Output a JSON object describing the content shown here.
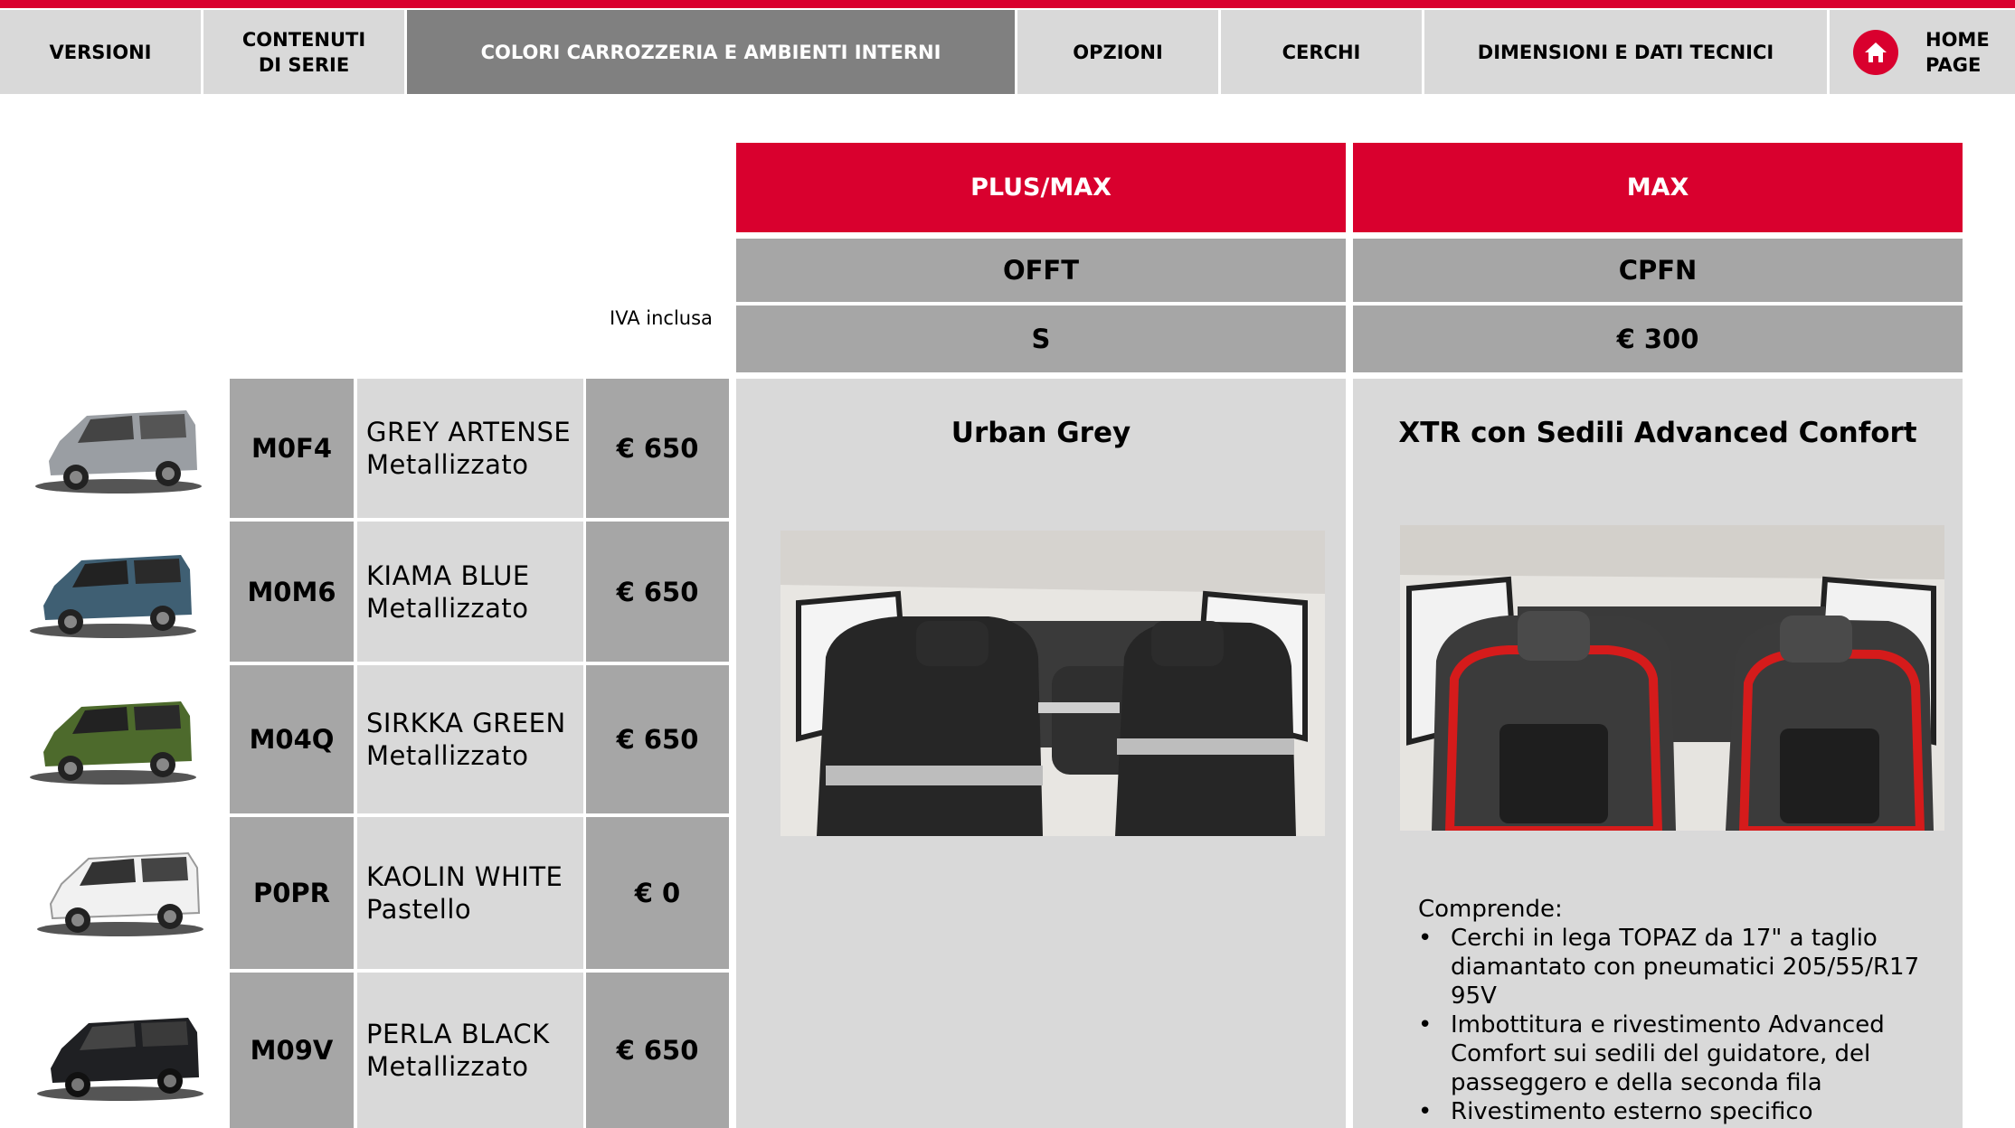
{
  "nav": {
    "tabs": [
      {
        "label": "VERSIONI"
      },
      {
        "label_line1": "CONTENUTI",
        "label_line2": "DI SERIE"
      },
      {
        "label": "COLORI CARROZZERIA E AMBIENTI INTERNI",
        "active": true
      },
      {
        "label": "OPZIONI"
      },
      {
        "label": "CERCHI"
      },
      {
        "label": "DIMENSIONI E DATI TECNICI"
      }
    ],
    "home": {
      "line1": "HOME",
      "line2": "PAGE",
      "icon": "home-icon"
    }
  },
  "iva_note": "IVA inclusa",
  "columns": [
    {
      "trim": "PLUS/MAX",
      "code": "OFFT",
      "price": "S",
      "title": "Urban Grey"
    },
    {
      "trim": "MAX",
      "code": "CPFN",
      "price": "€ 300",
      "title": "XTR con Sedili Advanced Confort"
    }
  ],
  "colors": [
    {
      "code": "M0F4",
      "name": "GREY ARTENSE",
      "finish": "Metallizzato",
      "price": "€ 650",
      "swatch": "#9a9ea3"
    },
    {
      "code": "M0M6",
      "name": "KIAMA BLUE",
      "finish": "Metallizzato",
      "price": "€ 650",
      "swatch": "#3f5f73"
    },
    {
      "code": "M04Q",
      "name": "SIRKKA GREEN",
      "finish": "Metallizzato",
      "price": "€ 650",
      "swatch": "#4d6a2c"
    },
    {
      "code": "P0PR",
      "name": "KAOLIN WHITE",
      "finish": "Pastello",
      "price": "€ 0",
      "swatch": "#f1f1f1"
    },
    {
      "code": "M09V",
      "name": "PERLA BLACK",
      "finish": "Metallizzato",
      "price": "€ 650",
      "swatch": "#1f2023"
    }
  ],
  "includes": {
    "heading": "Comprende:",
    "items": [
      "Cerchi in lega TOPAZ da 17\" a taglio diamantato con pneumatici 205/55/R17 95V",
      "Imbottitura e rivestimento Advanced Comfort sui sedili del guidatore, del passeggero e della seconda fila",
      "Rivestimento esterno specifico"
    ]
  },
  "colors_theme": {
    "accent": "#d9002e",
    "grey_dark": "#a6a6a6",
    "grey_light": "#d9d9d9",
    "tab_active": "#808080"
  }
}
